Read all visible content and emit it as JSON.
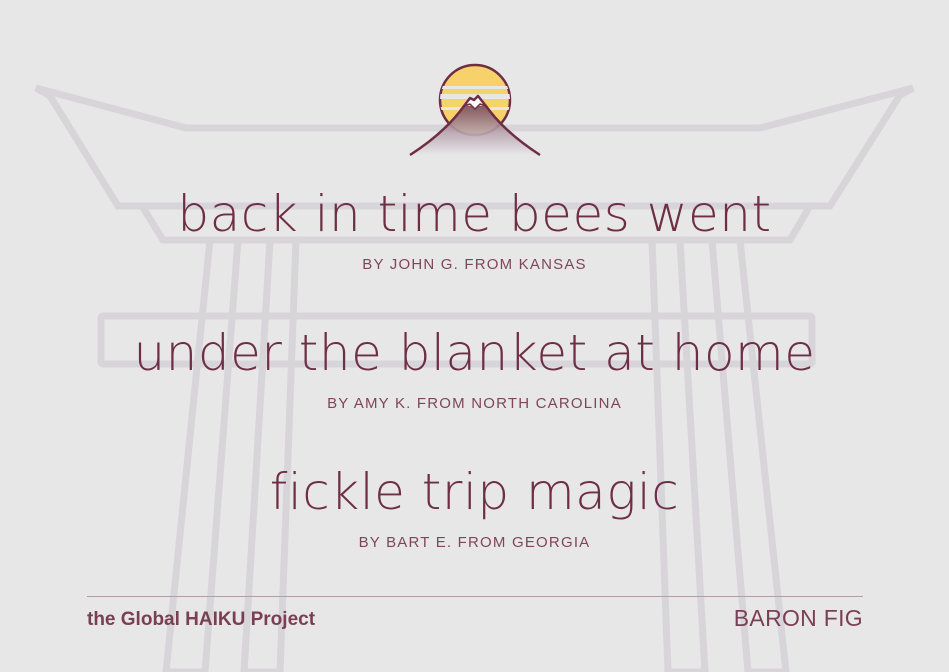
{
  "theme": {
    "background": "#e7e7e8",
    "text_color": "#6e2e43",
    "accent_sun": "#f7d26b",
    "outline_color": "#6e2e43",
    "torii_stroke": "#d7d5d7"
  },
  "logo": {
    "icon": "sun-mountain-icon"
  },
  "haikus": [
    {
      "text": "back in time bees went",
      "byline": "BY JOHN G. FROM KANSAS"
    },
    {
      "text": "under the blanket at home",
      "byline": "BY AMY K. FROM NORTH CAROLINA"
    },
    {
      "text": "fickle trip magic",
      "byline": "BY BART E. FROM GEORGIA"
    }
  ],
  "footer": {
    "project_title": "the Global HAIKU Project",
    "brand": "BARON FIG"
  }
}
